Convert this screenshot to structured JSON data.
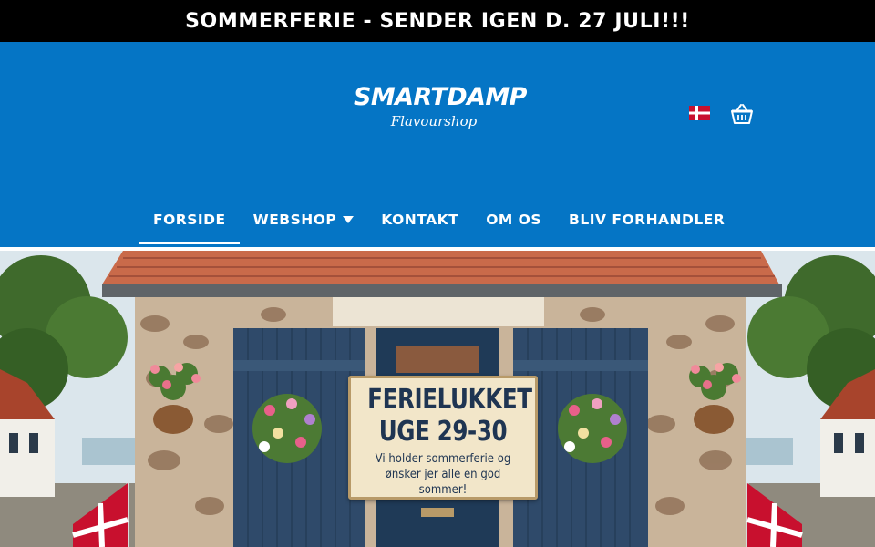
{
  "announcement": {
    "text": "SOMMERFERIE - SENDER IGEN D. 27 JULI!!!"
  },
  "logo": {
    "main": "SMARTDAMP",
    "sub": "Flavourshop"
  },
  "header": {
    "language_icon": "danish-flag-icon",
    "cart_icon": "basket-icon"
  },
  "nav": {
    "items": [
      {
        "label": "FORSIDE",
        "active": true
      },
      {
        "label": "WEBSHOP",
        "has_dropdown": true
      },
      {
        "label": "KONTAKT"
      },
      {
        "label": "OM OS"
      },
      {
        "label": "BLIV FORHANDLER"
      }
    ]
  },
  "hero": {
    "sign_title": "FERIELUKKET",
    "sign_subtitle": "UGE 29-30",
    "sign_text": "Vi holder sommerferie og ønsker jer alle en god sommer!"
  },
  "colors": {
    "header_bg": "#0575c5",
    "announce_bg": "#000000",
    "text": "#ffffff"
  }
}
